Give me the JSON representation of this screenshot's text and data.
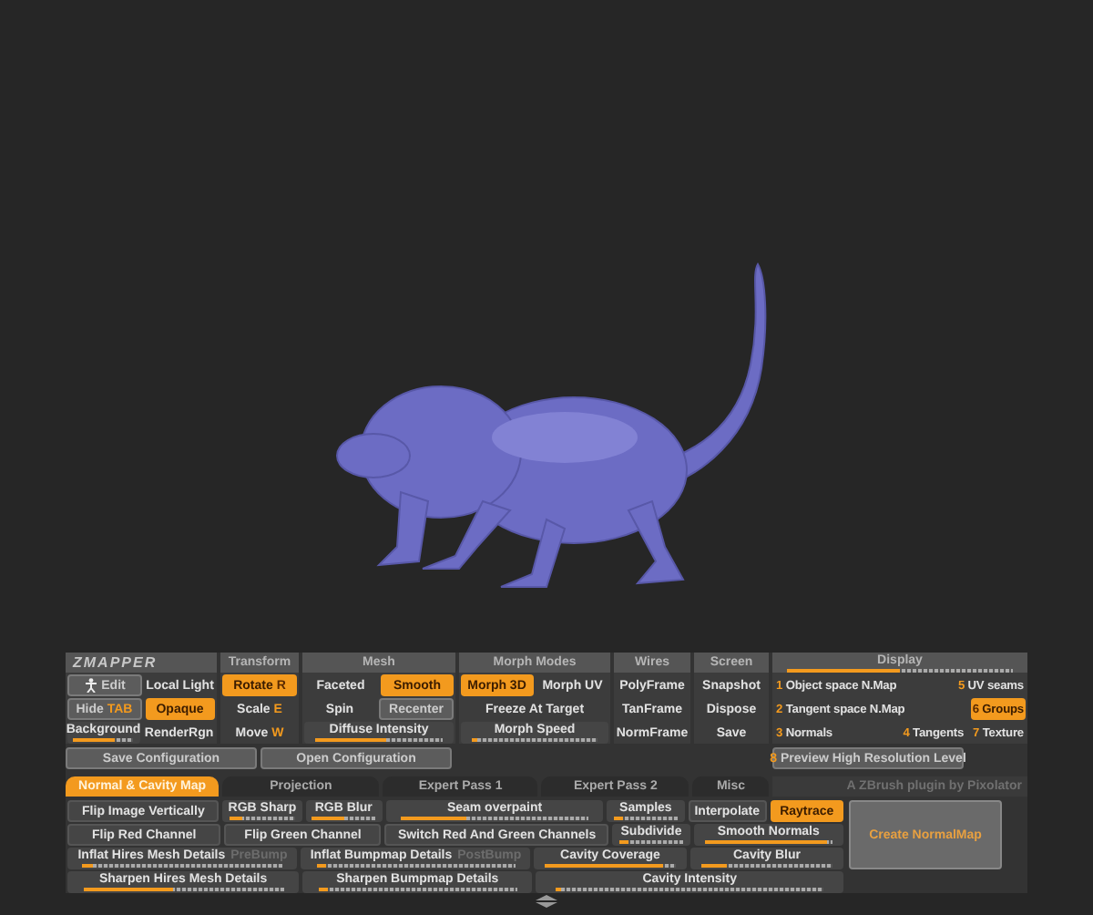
{
  "top": {
    "columns": [
      {
        "kind": "brand",
        "title": "ZMAPPER",
        "rows": [
          [
            {
              "kind": "icon_button",
              "label": "Edit"
            },
            {
              "kind": "toggle",
              "label": "Local Light",
              "selected": false
            }
          ],
          [
            {
              "kind": "button",
              "label": "Hide",
              "hotkey": "TAB"
            },
            {
              "kind": "toggle",
              "label": "Opaque",
              "selected": true
            }
          ],
          [
            {
              "kind": "slider",
              "label": "Background",
              "level": 0.7
            },
            {
              "kind": "toggle",
              "label": "RenderRgn",
              "selected": false
            }
          ]
        ]
      },
      {
        "kind": "header",
        "title": "Transform",
        "rows": [
          [
            {
              "kind": "toggle",
              "label": "Rotate",
              "hotkey": "R",
              "selected": true
            }
          ],
          [
            {
              "kind": "toggle",
              "label": "Scale",
              "hotkey": "E",
              "selected": false
            }
          ],
          [
            {
              "kind": "toggle",
              "label": "Move",
              "hotkey": "W",
              "selected": false
            }
          ]
        ]
      },
      {
        "kind": "header",
        "title": "Mesh",
        "rows": [
          [
            {
              "kind": "toggle",
              "label": "Faceted",
              "selected": false
            },
            {
              "kind": "toggle",
              "label": "Smooth",
              "selected": true
            }
          ],
          [
            {
              "kind": "toggle",
              "label": "Spin",
              "selected": false
            },
            {
              "kind": "button",
              "label": "Recenter"
            }
          ],
          [
            {
              "kind": "slider",
              "label": "Diffuse Intensity",
              "level": 0.55
            }
          ]
        ]
      },
      {
        "kind": "header",
        "title": "Morph Modes",
        "rows": [
          [
            {
              "kind": "toggle",
              "label": "Morph 3D",
              "selected": true
            },
            {
              "kind": "toggle",
              "label": "Morph UV",
              "selected": false
            }
          ],
          [
            {
              "kind": "toggle",
              "label": "Freeze At Target",
              "selected": false
            }
          ],
          [
            {
              "kind": "slider",
              "label": "Morph Speed",
              "level": 0.05
            }
          ]
        ]
      },
      {
        "kind": "header",
        "title": "Wires",
        "rows": [
          [
            {
              "kind": "toggle",
              "label": "PolyFrame",
              "selected": false
            }
          ],
          [
            {
              "kind": "toggle",
              "label": "TanFrame",
              "selected": false
            }
          ],
          [
            {
              "kind": "toggle",
              "label": "NormFrame",
              "selected": false
            }
          ]
        ]
      },
      {
        "kind": "header",
        "title": "Screen",
        "rows": [
          [
            {
              "kind": "action",
              "label": "Snapshot"
            }
          ],
          [
            {
              "kind": "action",
              "label": "Dispose"
            }
          ],
          [
            {
              "kind": "action",
              "label": "Save"
            }
          ]
        ]
      },
      {
        "kind": "slider_header",
        "title": "Display",
        "level": 0.5,
        "rows": [
          [
            {
              "kind": "toggle",
              "key": "1",
              "label": "Object space N.Map",
              "selected": false
            },
            {
              "kind": "toggle",
              "key": "5",
              "label": "UV seams",
              "selected": false
            }
          ],
          [
            {
              "kind": "toggle",
              "key": "2",
              "label": "Tangent space N.Map",
              "selected": false
            },
            {
              "kind": "toggle",
              "key": "6",
              "label": "Groups",
              "selected": true
            }
          ],
          [
            {
              "kind": "toggle",
              "key": "3",
              "label": "Normals",
              "selected": false
            },
            {
              "kind": "toggle",
              "key": "4",
              "label": "Tangents",
              "selected": false
            },
            {
              "kind": "toggle",
              "key": "7",
              "label": "Texture",
              "selected": false
            }
          ]
        ]
      }
    ],
    "config_buttons": [
      {
        "kind": "button",
        "label": "Save Configuration"
      },
      {
        "kind": "button",
        "label": "Open Configuration"
      }
    ],
    "preview_button": {
      "kind": "button",
      "key": "8",
      "label": "Preview High Resolution Level"
    }
  },
  "tabs": [
    {
      "label": "Normal & Cavity Map",
      "selected": true
    },
    {
      "label": "Projection",
      "selected": false
    },
    {
      "label": "Expert Pass 1",
      "selected": false
    },
    {
      "label": "Expert Pass 2",
      "selected": false
    },
    {
      "label": "Misc",
      "selected": false
    }
  ],
  "credit": "A ZBrush plugin by Pixolator",
  "rows": [
    [
      {
        "kind": "toggle",
        "label": "Flip Image Vertically",
        "selected": false
      },
      {
        "kind": "slider",
        "label": "RGB Sharp",
        "level": 0.2
      },
      {
        "kind": "slider",
        "label": "RGB Blur",
        "level": 0.5
      },
      {
        "kind": "slider",
        "label": "Seam overpaint",
        "level": 0.35
      },
      {
        "kind": "slider",
        "label": "Samples",
        "level": 0.15
      },
      {
        "kind": "action",
        "label": "Interpolate"
      },
      {
        "kind": "toggle",
        "label": "Raytrace",
        "selected": true
      }
    ],
    [
      {
        "kind": "toggle",
        "label": "Flip Red Channel",
        "selected": false
      },
      {
        "kind": "toggle",
        "label": "Flip Green Channel",
        "selected": false
      },
      {
        "kind": "toggle",
        "label": "Switch Red And Green Channels",
        "selected": false
      },
      {
        "kind": "slider",
        "label": "Subdivide",
        "level": 0.15
      },
      {
        "kind": "slider",
        "label": "Smooth Normals",
        "level": 0.95
      }
    ],
    [
      {
        "kind": "slider",
        "label": "Inflat Hires Mesh Details",
        "suffix": "PreBump",
        "level": 0.05
      },
      {
        "kind": "slider",
        "label": "Inflat Bumpmap Details",
        "suffix": "PostBump",
        "level": 0.05
      },
      {
        "kind": "slider",
        "label": "Cavity Coverage",
        "level": 0.9
      },
      {
        "kind": "slider",
        "label": "Cavity Blur",
        "level": 0.2
      }
    ],
    [
      {
        "kind": "slider",
        "label": "Sharpen Hires Mesh Details",
        "level": 0.45
      },
      {
        "kind": "slider",
        "label": "Sharpen Bumpmap Details",
        "level": 0.05
      },
      {
        "kind": "slider",
        "label": "Cavity Intensity",
        "level": 0.02
      }
    ]
  ],
  "create_button": {
    "label": "Create NormalMap"
  }
}
